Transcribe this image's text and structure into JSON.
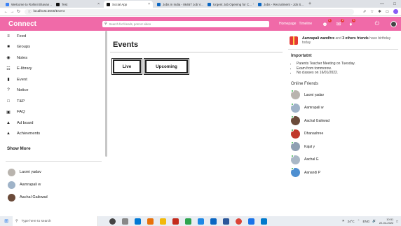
{
  "browser": {
    "tabs": [
      {
        "label": "Welcome to Rohini Bhavan ...",
        "active": false,
        "color": "#3b82f6"
      },
      {
        "label": "Test",
        "active": false,
        "color": "#111111"
      },
      {
        "label": "Social App",
        "active": true,
        "color": "#111111"
      },
      {
        "label": "Jobs in India - 86467 Job V...",
        "active": false,
        "color": "#0a66c2"
      },
      {
        "label": "Urgent Job Opening for C...",
        "active": false,
        "color": "#0a66c2"
      },
      {
        "label": "Jobs - Recruitment - Job S...",
        "active": false,
        "color": "#0a66c2"
      }
    ],
    "new_tab": "+",
    "url": "localhost:3000/Event"
  },
  "app": {
    "brand": "Connect",
    "search_placeholder": "Search for friends, post or video",
    "links": [
      "Homepage",
      "Timeline"
    ],
    "badges": {
      "people": "1",
      "chat": "2",
      "bell": "1"
    }
  },
  "sidebar": {
    "items": [
      {
        "label": "Feed",
        "icon": "rss-icon",
        "glyph": "≡"
      },
      {
        "label": "Groups",
        "icon": "chat-icon",
        "glyph": "■"
      },
      {
        "label": "Notes",
        "icon": "play-circle-icon",
        "glyph": "◉"
      },
      {
        "label": "E-library",
        "icon": "people-icon",
        "glyph": "☷"
      },
      {
        "label": "Event",
        "icon": "bookmark-icon",
        "glyph": "▮"
      },
      {
        "label": "Notice",
        "icon": "help-icon",
        "glyph": "?"
      },
      {
        "label": "T&P",
        "icon": "work-icon",
        "glyph": "□"
      },
      {
        "label": "FAQ",
        "icon": "event-icon",
        "glyph": "▣"
      },
      {
        "label": "Ad board",
        "icon": "school-icon",
        "glyph": "▲"
      },
      {
        "label": "Achievments",
        "icon": "school-icon",
        "glyph": "▲"
      }
    ],
    "show_more": "Show More",
    "friends": [
      {
        "name": "Laxmi yadav",
        "color": "#b9b4ae"
      },
      {
        "name": "Aamrapali w",
        "color": "#9fb3c8"
      },
      {
        "name": "Aachal Gaikwad",
        "color": "#6b4b3a"
      }
    ]
  },
  "main": {
    "title": "Events",
    "buttons": [
      "Live",
      "Upcoming"
    ]
  },
  "right": {
    "birthday": {
      "name": "Aamrapali wandhre",
      "text1": " and ",
      "others": "3 others friends",
      "text2": " have birthday today"
    },
    "important": {
      "title": "Importatnt",
      "items": [
        "Parents Teacher Meeting on Tuesday.",
        "Exam from tommorow.",
        "No classes on 16/01/2022."
      ]
    },
    "online_title": "Online Friends",
    "online": [
      {
        "name": "Laxmi yadav",
        "color": "#b9b4ae"
      },
      {
        "name": "Aamrapali w",
        "color": "#9fb3c8"
      },
      {
        "name": "Aachal Gaikwad",
        "color": "#6b4b3a"
      },
      {
        "name": "Dhanashree",
        "color": "#c0392b"
      },
      {
        "name": "Kajal y",
        "color": "#8fa0b3"
      },
      {
        "name": "Aachal G",
        "color": "#a9b8c6"
      },
      {
        "name": "Aanandi P",
        "color": "#4e8fd1"
      }
    ]
  },
  "taskbar": {
    "search_placeholder": "Type here to search",
    "weather": "24°C",
    "lang": "ENG",
    "time": "10:51",
    "date": "22-04-2022"
  }
}
